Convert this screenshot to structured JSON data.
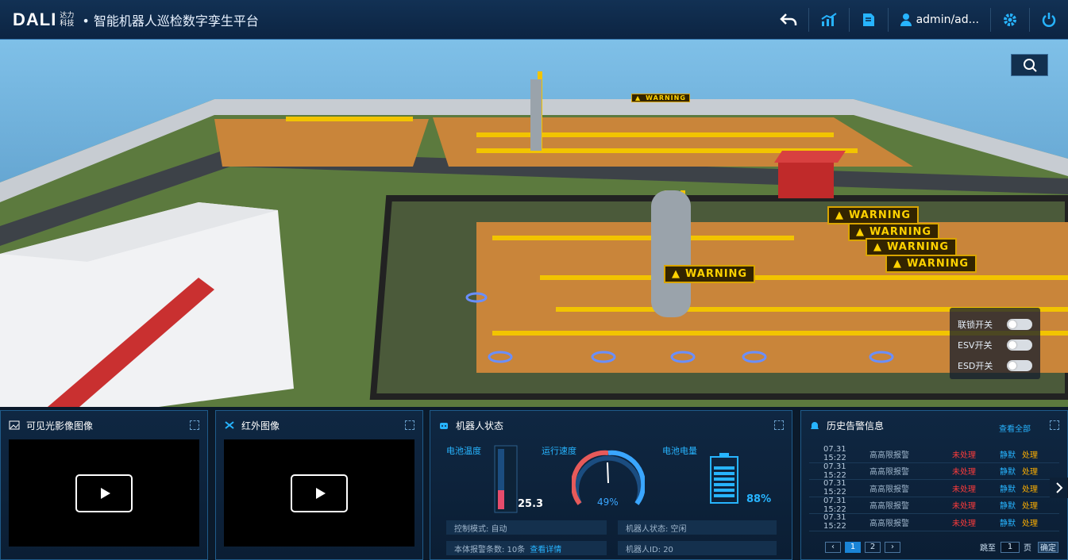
{
  "header": {
    "logo_mark": "DALI",
    "logo_sub": "达力科技",
    "title": "• 智能机器人巡检数字孪生平台",
    "user": "admin/ad..."
  },
  "scene": {
    "warnings": [
      "WARNING",
      "WARNING",
      "WARNING",
      "WARNING",
      "WARNING",
      "WARNING"
    ],
    "switches": [
      {
        "label": "联锁开关",
        "on": false
      },
      {
        "label": "ESV开关",
        "on": false
      },
      {
        "label": "ESD开关",
        "on": false
      }
    ]
  },
  "panels": {
    "visible": {
      "title": "可见光影像图像"
    },
    "infrared": {
      "title": "红外图像"
    },
    "robot": {
      "title": "机器人状态",
      "battery_temp_label": "电池温度",
      "speed_label": "运行速度",
      "battery_label": "电池电量",
      "temp_value": "25.3",
      "speed_value": "49%",
      "speed_fraction": 0.49,
      "battery_value": "88%",
      "battery_fraction": 0.88,
      "control_mode": "控制模式: 自动",
      "robot_state": "机器人状态: 空闲",
      "alarm_count": "本体报警条数: 10条",
      "view_detail": "查看详情",
      "robot_id": "机器人ID: 20"
    },
    "alarms": {
      "title": "历史告警信息",
      "view_all": "查看全部",
      "items": [
        {
          "time": "07.31 15:22",
          "kind": "高高限报警",
          "status": "未处理",
          "mute": "静默",
          "handle": "处理"
        },
        {
          "time": "07.31 15:22",
          "kind": "高高限报警",
          "status": "未处理",
          "mute": "静默",
          "handle": "处理"
        },
        {
          "time": "07.31 15:22",
          "kind": "高高限报警",
          "status": "未处理",
          "mute": "静默",
          "handle": "处理"
        },
        {
          "time": "07.31 15:22",
          "kind": "高高限报警",
          "status": "未处理",
          "mute": "静默",
          "handle": "处理"
        },
        {
          "time": "07.31 15:22",
          "kind": "高高限报警",
          "status": "未处理",
          "mute": "静默",
          "handle": "处理"
        }
      ],
      "pager": {
        "pages": [
          "1",
          "2"
        ],
        "goto_label": "跳至",
        "page_input": "1",
        "page_suffix": "页",
        "confirm": "确定"
      }
    }
  }
}
